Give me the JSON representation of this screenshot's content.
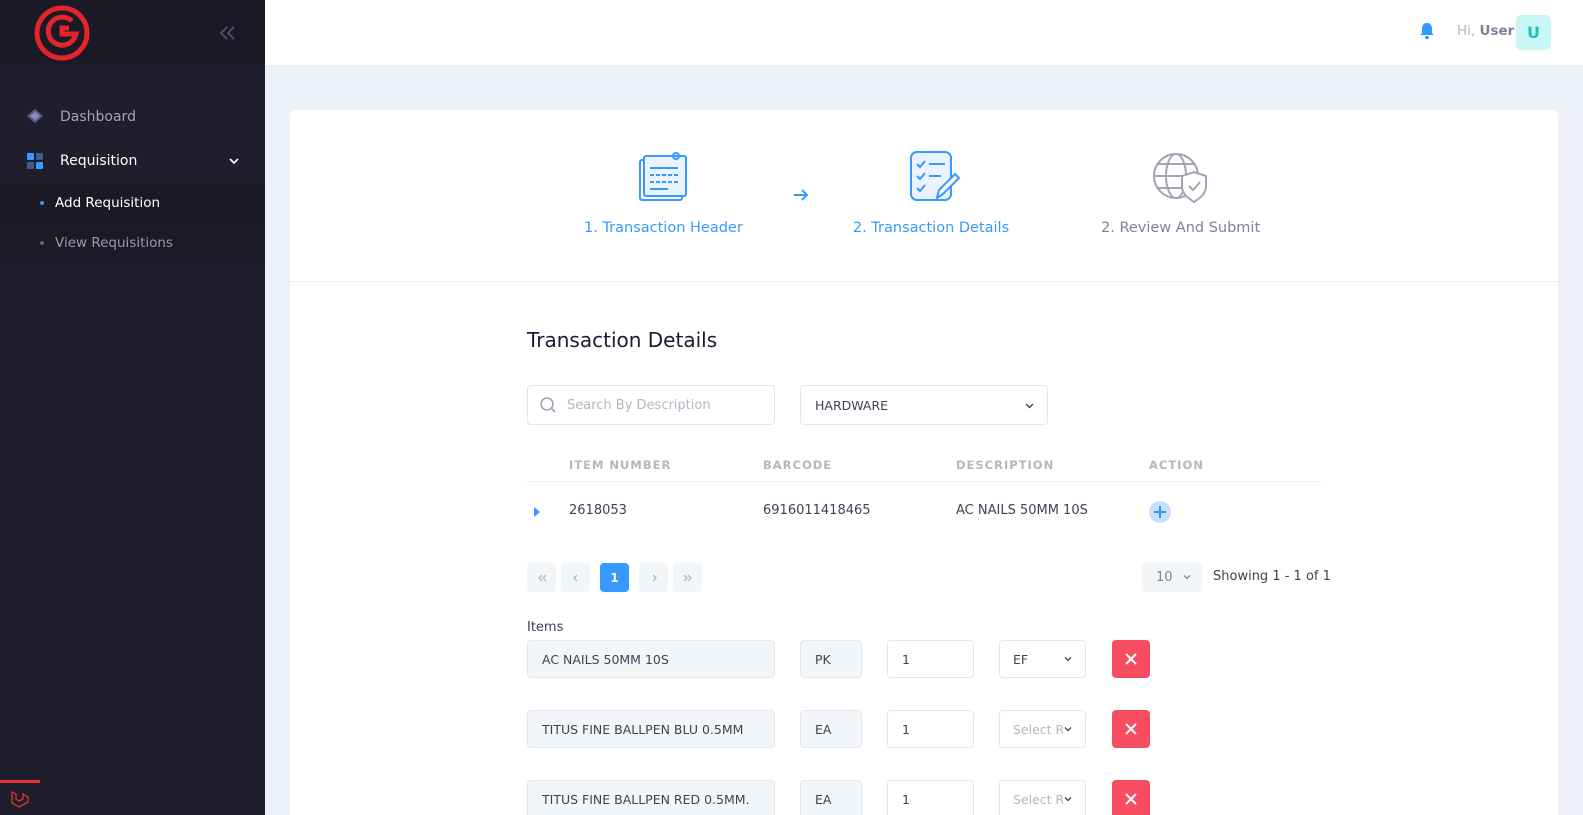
{
  "header": {
    "greeting": "Hi,",
    "user_name": "User",
    "avatar_initial": "U"
  },
  "sidebar": {
    "items": [
      {
        "label": "Dashboard",
        "icon": "diamond-layers-icon"
      },
      {
        "label": "Requisition",
        "icon": "grid-icon"
      }
    ],
    "submenu": [
      {
        "label": "Add Requisition"
      },
      {
        "label": "View Requisitions"
      }
    ]
  },
  "wizard": {
    "steps": [
      {
        "label": "1. Transaction Header",
        "icon": "clipboard-note-icon",
        "state": "done"
      },
      {
        "label": "2. Transaction Details",
        "icon": "checklist-edit-icon",
        "state": "current"
      },
      {
        "label": "2. Review And Submit",
        "icon": "globe-shield-icon",
        "state": "pending"
      }
    ]
  },
  "details": {
    "title": "Transaction Details",
    "search_placeholder": "Search By Description",
    "category_selected": "HARDWARE"
  },
  "table": {
    "columns": [
      "ITEM NUMBER",
      "BARCODE",
      "DESCRIPTION",
      "ACTION"
    ],
    "rows": [
      {
        "item_number": "2618053",
        "barcode": "6916011418465",
        "description": "AC NAILS 50MM 10S"
      }
    ]
  },
  "pager": {
    "current_page": "1",
    "per_page": "10",
    "showing": "Showing 1 - 1 of 1"
  },
  "items": {
    "label": "Items",
    "rows": [
      {
        "description": "AC NAILS 50MM 10S",
        "uom": "PK",
        "qty": "1",
        "select": "EF",
        "select_is_placeholder": false
      },
      {
        "description": "TITUS FINE BALLPEN BLU 0.5MM",
        "uom": "EA",
        "qty": "1",
        "select": "Select R",
        "select_is_placeholder": true
      },
      {
        "description": "TITUS FINE BALLPEN RED 0.5MM.",
        "uom": "EA",
        "qty": "1",
        "select": "Select R",
        "select_is_placeholder": true
      }
    ]
  },
  "colors": {
    "primary": "#3699ff",
    "danger": "#f64e60",
    "sidebar_bg": "#1e1e2d",
    "brand_red": "#e3242b"
  }
}
